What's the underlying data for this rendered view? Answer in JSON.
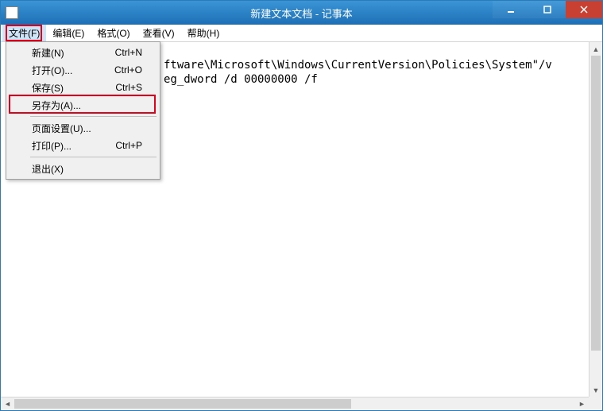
{
  "titlebar": {
    "title": "新建文本文档 - 记事本"
  },
  "menubar": {
    "items": [
      {
        "label": "文件(F)"
      },
      {
        "label": "编辑(E)"
      },
      {
        "label": "格式(O)"
      },
      {
        "label": "查看(V)"
      },
      {
        "label": "帮助(H)"
      }
    ]
  },
  "dropdown": {
    "items": [
      {
        "label": "新建(N)",
        "shortcut": "Ctrl+N"
      },
      {
        "label": "打开(O)...",
        "shortcut": "Ctrl+O"
      },
      {
        "label": "保存(S)",
        "shortcut": "Ctrl+S"
      },
      {
        "label": "另存为(A)...",
        "shortcut": ""
      },
      {
        "sep": true
      },
      {
        "label": "页面设置(U)...",
        "shortcut": ""
      },
      {
        "label": "打印(P)...",
        "shortcut": "Ctrl+P"
      },
      {
        "sep": true
      },
      {
        "label": "退出(X)",
        "shortcut": ""
      }
    ]
  },
  "content": {
    "line1": "ftware\\Microsoft\\Windows\\CurrentVersion\\Policies\\System\"/v",
    "line2": "eg_dword /d 00000000 /f"
  }
}
